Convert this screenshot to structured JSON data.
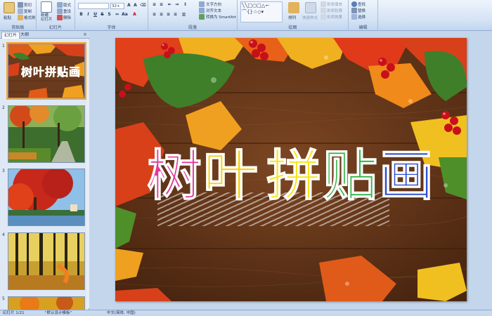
{
  "ribbon": {
    "groups": {
      "clipboard": "剪贴板",
      "slides": "幻灯片",
      "font": "字体",
      "paragraph": "段落",
      "drawing": "绘图",
      "editing": "编辑"
    },
    "clipboard": {
      "paste": "粘贴",
      "cut": "剪切",
      "copy": "复制",
      "format_painter": "格式刷"
    },
    "slides": {
      "new_slide": "新建\n幻灯片",
      "layout": "版式",
      "reset": "重设",
      "delete": "删除"
    },
    "font": {
      "font_size": "32+"
    },
    "paragraph": {
      "text_direction": "文字方向",
      "align_text": "对齐文本",
      "smartart": "转换为 SmartArt"
    },
    "drawing": {
      "arrange": "排列",
      "quick_styles": "快速样式",
      "shape_fill": "形状填充",
      "shape_outline": "形状轮廓",
      "shape_effects": "形状效果"
    },
    "editing": {
      "find": "查找",
      "replace": "替换",
      "select": "选择"
    }
  },
  "left_pane": {
    "tabs": [
      "幻灯片",
      "大纲"
    ],
    "slide_numbers": [
      "1",
      "2",
      "3",
      "4",
      "5"
    ],
    "thumb1_title": "树叶拼贴画"
  },
  "slide": {
    "title_chars": [
      "树",
      "叶",
      "拼",
      "贴",
      "画"
    ]
  },
  "status": {
    "slide_info": "幻灯片 1/21",
    "theme": "\"默认设计模板\"",
    "language": "中文(简体, 中国)"
  },
  "colors": {
    "ribbon_bg": "#d3e2f5",
    "wood": "#6b3a1c",
    "title_gradient": [
      "#e03a9a",
      "#f5d21d",
      "#f6e61d",
      "#37b34a",
      "#2e4fd0",
      "#7a2bc9"
    ]
  }
}
